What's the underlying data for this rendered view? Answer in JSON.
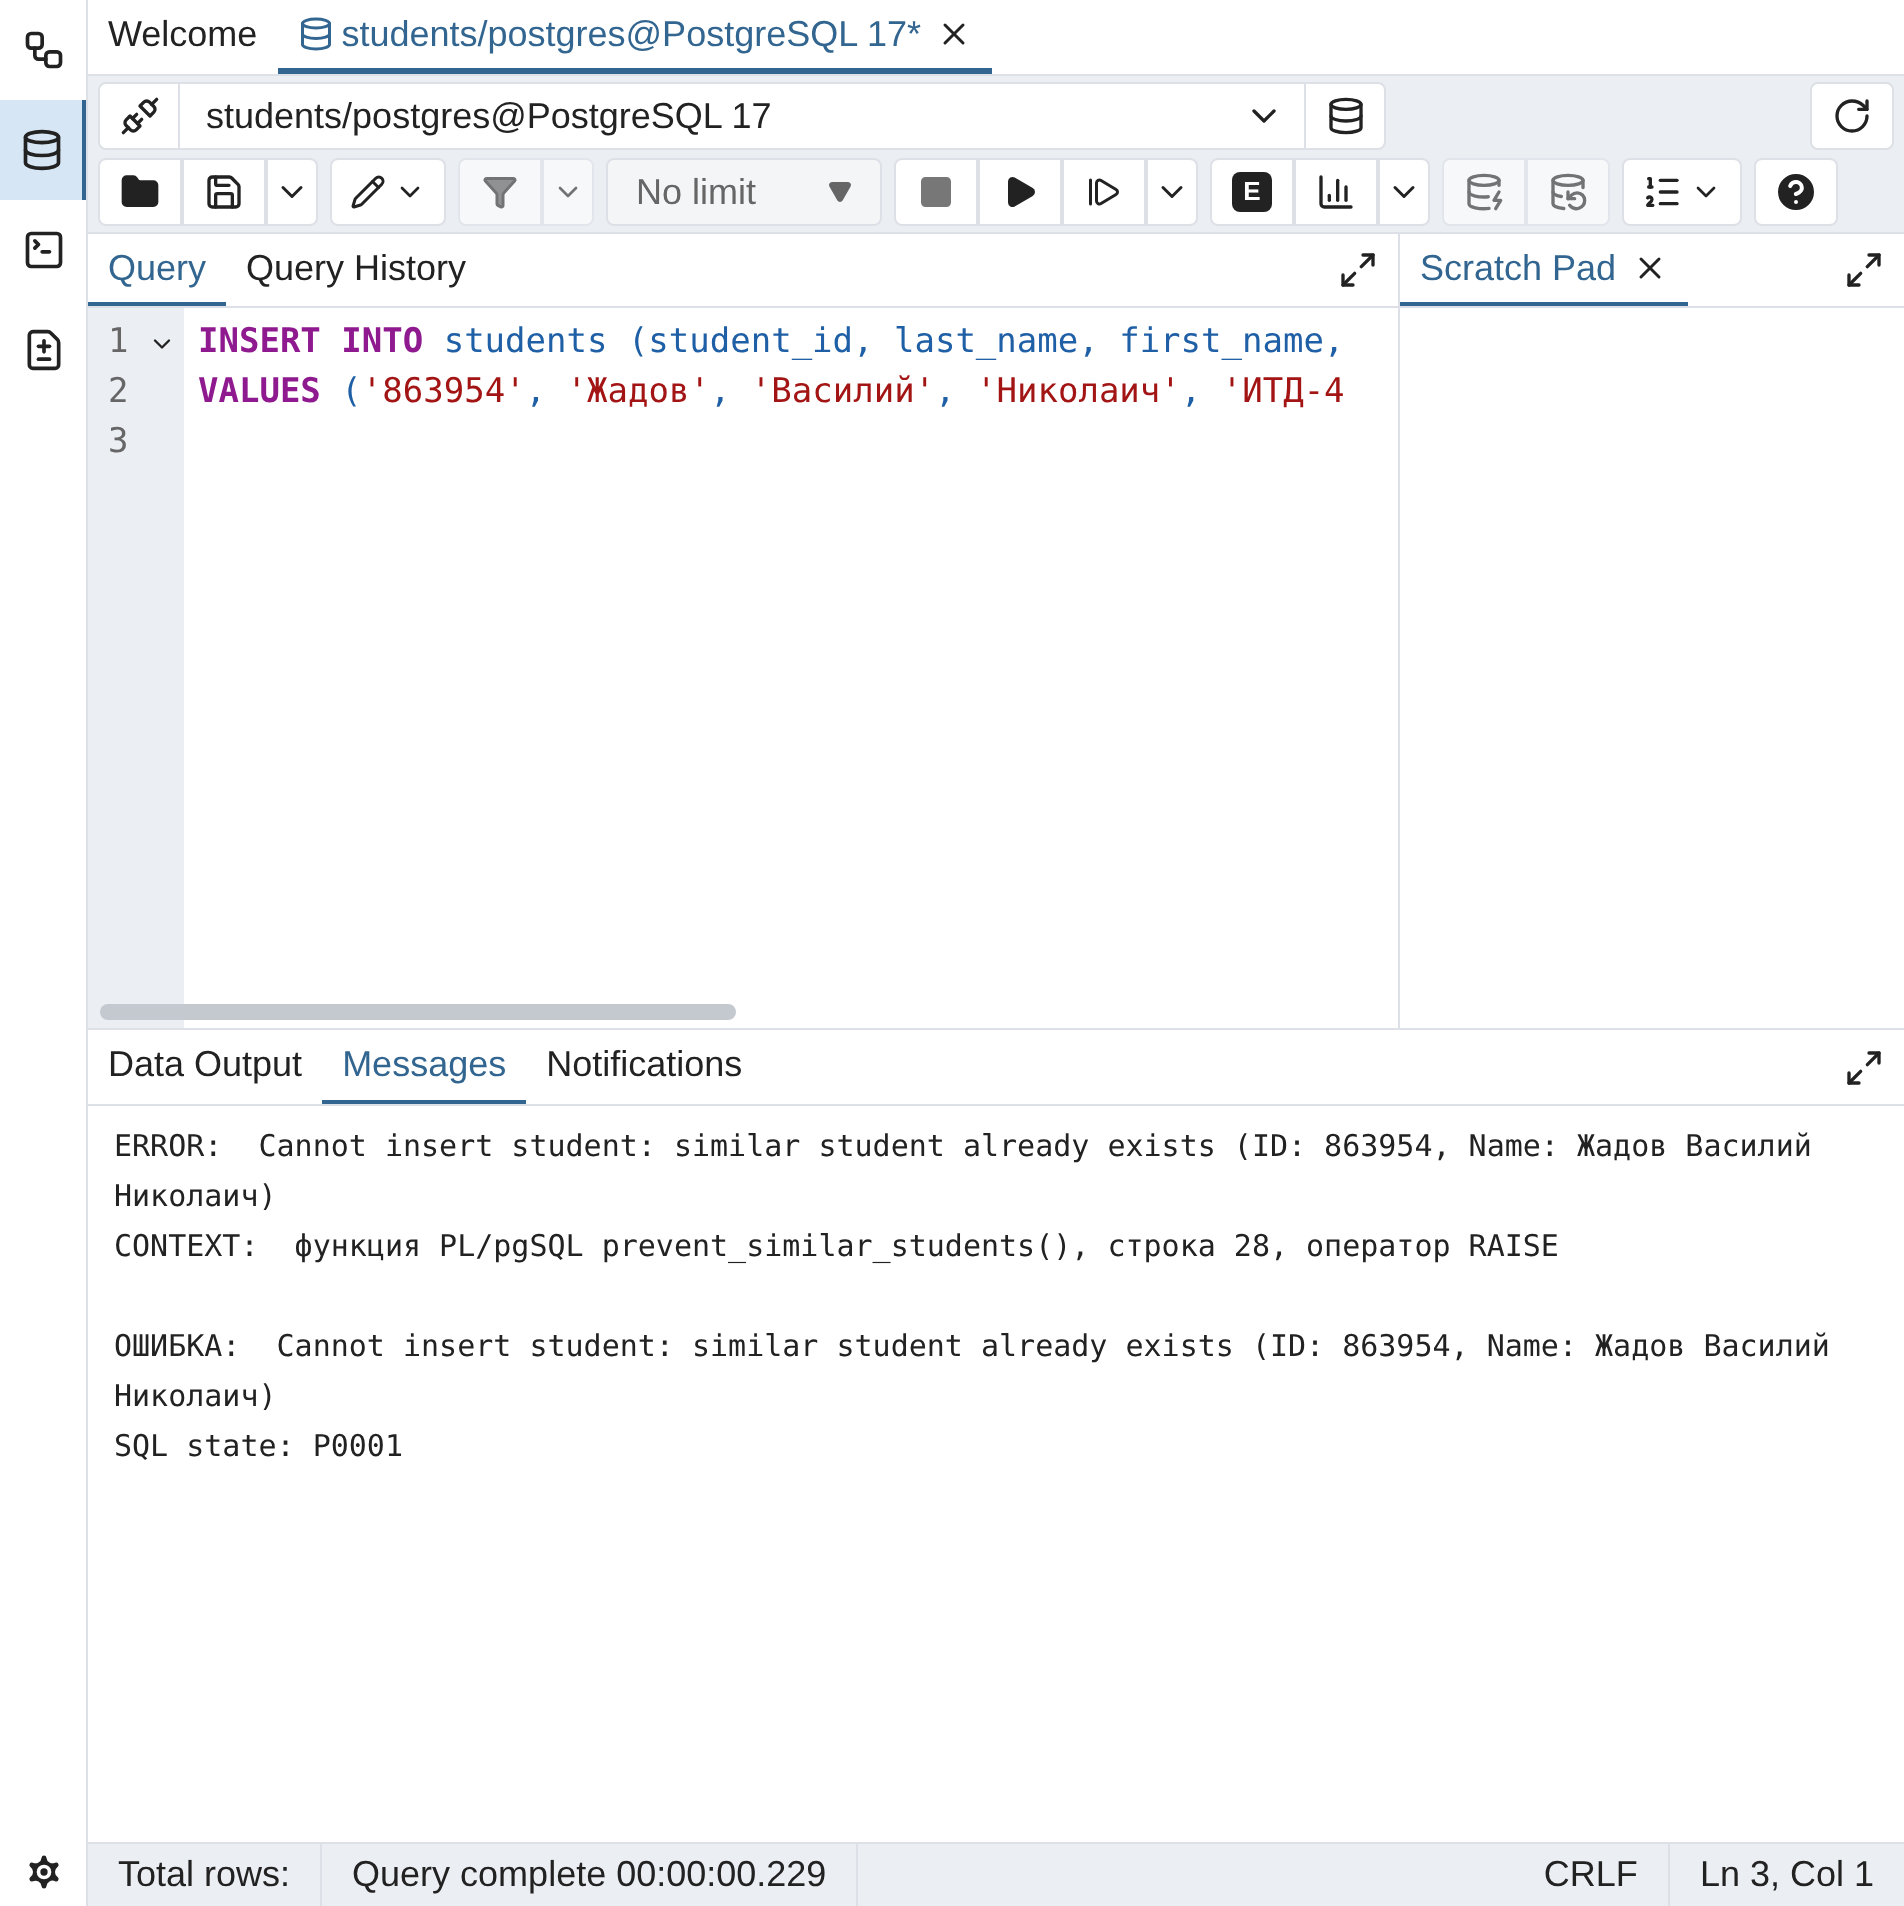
{
  "sidebar": [
    {
      "kind": "explorer",
      "selected": false
    },
    {
      "kind": "query",
      "selected": true
    },
    {
      "kind": "psql",
      "selected": false
    },
    {
      "kind": "schema_diff",
      "selected": false
    }
  ],
  "tabs": [
    {
      "label": "Welcome",
      "selected": false,
      "closable": false
    },
    {
      "label": "students/postgres@PostgreSQL 17*",
      "selected": true,
      "closable": true
    }
  ],
  "connection": {
    "value": "students/postgres@PostgreSQL 17"
  },
  "toolbar": {
    "limit": "No limit",
    "explain_label": "E"
  },
  "query_tabs": [
    {
      "label": "Query",
      "selected": true
    },
    {
      "label": "Query History",
      "selected": false
    }
  ],
  "scratch_tabs": [
    {
      "label": "Scratch Pad",
      "selected": true
    }
  ],
  "editor": {
    "lines": [
      {
        "number": "1",
        "fold": true,
        "tokens": [
          {
            "kind": "keyword",
            "text": "INSERT INTO"
          },
          {
            "kind": "ident",
            "text": " students (student_id, last_name, first_name,"
          }
        ]
      },
      {
        "number": "2",
        "fold": false,
        "tokens": [
          {
            "kind": "keyword",
            "text": "VALUES"
          },
          {
            "kind": "ident",
            "text": " ("
          },
          {
            "kind": "string",
            "text": "'863954'"
          },
          {
            "kind": "ident",
            "text": ", "
          },
          {
            "kind": "string",
            "text": "'Жадов'"
          },
          {
            "kind": "ident",
            "text": ", "
          },
          {
            "kind": "string",
            "text": "'Василий'"
          },
          {
            "kind": "ident",
            "text": ", "
          },
          {
            "kind": "string",
            "text": "'Николаич'"
          },
          {
            "kind": "ident",
            "text": ", "
          },
          {
            "kind": "string",
            "text": "'ИТД-4"
          }
        ]
      },
      {
        "number": "3",
        "fold": false
      }
    ]
  },
  "result_tabs": [
    {
      "label": "Data Output",
      "selected": false
    },
    {
      "label": "Messages",
      "selected": true
    },
    {
      "label": "Notifications",
      "selected": false
    }
  ],
  "messages": [
    [
      "ERROR:  Cannot insert student: similar student already exists (ID: 863954, Name: Жадов Василий Николаич)",
      "CONTEXT:  функция PL/pgSQL prevent_similar_students(), строка 28, оператор RAISE"
    ],
    [
      "ОШИБКА:  Cannot insert student: similar student already exists (ID: 863954, Name: Жадов Василий Николаич)",
      "SQL state: P0001"
    ]
  ],
  "status_bar": {
    "total_rows": "Total rows:",
    "query_status": "Query complete 00:00:00.229",
    "line_ending": "CRLF",
    "cursor": "Ln 3, Col 1"
  }
}
